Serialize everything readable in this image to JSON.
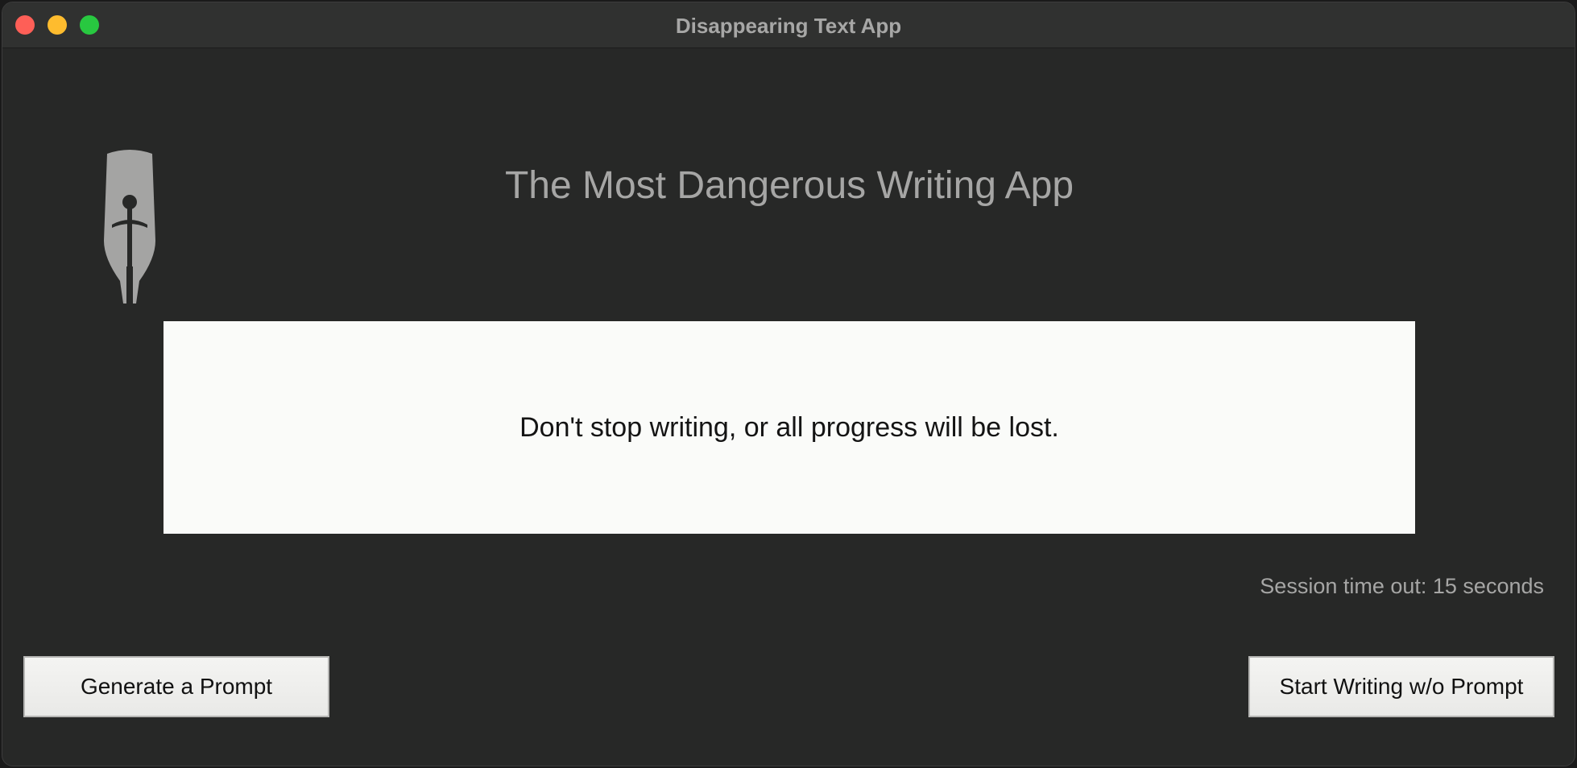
{
  "window": {
    "title": "Disappearing Text App"
  },
  "header": {
    "app_heading": "The Most Dangerous Writing App",
    "logo_icon": "fountain-pen-sword-icon"
  },
  "editor": {
    "message": "Don't stop writing, or all progress will be lost."
  },
  "status": {
    "timeout_text": "Session time out: 15 seconds"
  },
  "buttons": {
    "generate_prompt": "Generate a Prompt",
    "start_without_prompt": "Start Writing w/o Prompt"
  },
  "colors": {
    "background": "#272827",
    "text_muted": "#a6a6a5",
    "editor_bg": "#fafbf9"
  }
}
